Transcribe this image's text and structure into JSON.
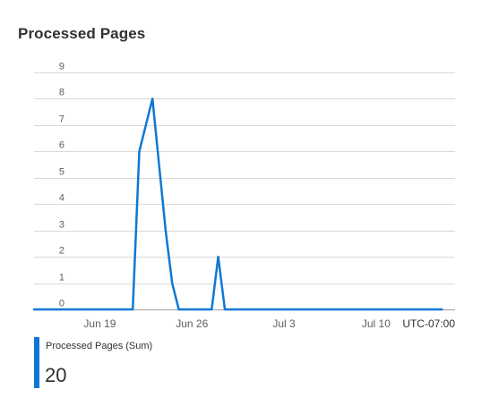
{
  "title": "Processed Pages",
  "timezone": "UTC-07:00",
  "colors": {
    "series": "#0f78d4",
    "grid": "#d9d9d9",
    "axis": "#9e9e9e"
  },
  "legend": {
    "label": "Processed Pages (Sum)",
    "value": "20"
  },
  "chart_data": {
    "type": "line",
    "title": "Processed Pages",
    "xlabel": "",
    "ylabel": "",
    "ylim": [
      0,
      9
    ],
    "yticks": [
      "0",
      "1",
      "2",
      "3",
      "4",
      "5",
      "6",
      "7",
      "8",
      "9"
    ],
    "xlim": [
      "2021-06-14",
      "2021-07-16"
    ],
    "xticks": [
      {
        "date": "2021-06-19",
        "label": "Jun 19"
      },
      {
        "date": "2021-06-26",
        "label": "Jun 26"
      },
      {
        "date": "2021-07-03",
        "label": "Jul 3"
      },
      {
        "date": "2021-07-10",
        "label": "Jul 10"
      }
    ],
    "grid": true,
    "series": [
      {
        "name": "Processed Pages (Sum)",
        "x": [
          "2021-06-14",
          "2021-06-21 12:00",
          "2021-06-22",
          "2021-06-23",
          "2021-06-24",
          "2021-06-24 12:00",
          "2021-06-25",
          "2021-06-27 12:00",
          "2021-06-28",
          "2021-06-28 12:00",
          "2021-07-15"
        ],
        "values": [
          0,
          0,
          6,
          8,
          3,
          1,
          0,
          0,
          2,
          0,
          0
        ]
      }
    ]
  }
}
